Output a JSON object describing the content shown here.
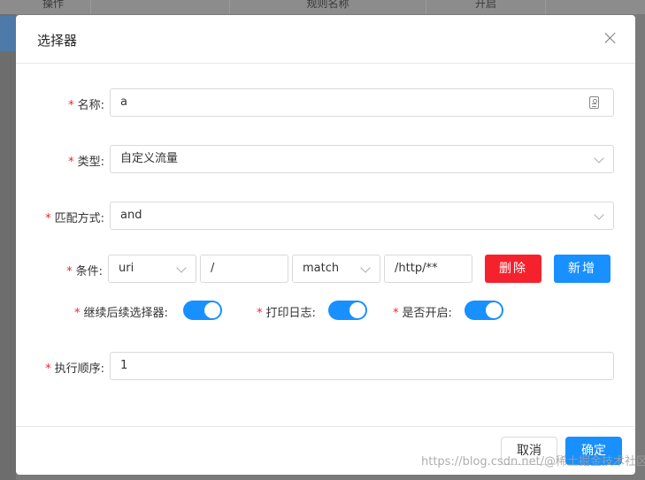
{
  "background": {
    "columns": [
      {
        "label": "操作"
      },
      {
        "label": "规则名称"
      },
      {
        "label": "开启"
      }
    ]
  },
  "modal": {
    "title": "选择器",
    "fields": {
      "name": {
        "label": "名称:",
        "value": "a"
      },
      "type": {
        "label": "类型:",
        "value": "自定义流量"
      },
      "match_mode": {
        "label": "匹配方式:",
        "value": "and"
      },
      "condition": {
        "label": "条件:",
        "param_type": "uri",
        "param_name": "/",
        "operator": "match",
        "param_value": "/http/**",
        "delete_label": "删除",
        "add_label": "新增"
      },
      "toggles": [
        {
          "label": "继续后续选择器:",
          "on": true
        },
        {
          "label": "打印日志:",
          "on": true
        },
        {
          "label": "是否开启:",
          "on": true
        }
      ],
      "order": {
        "label": "执行顺序:",
        "value": "1"
      }
    },
    "footer": {
      "cancel_label": "取消",
      "ok_label": "确定"
    }
  },
  "watermark": "https://blog.csdn.net/@稀土掘金技术社区",
  "colors": {
    "primary": "#1890ff",
    "danger": "#f5222d",
    "required": "#f5222d"
  }
}
